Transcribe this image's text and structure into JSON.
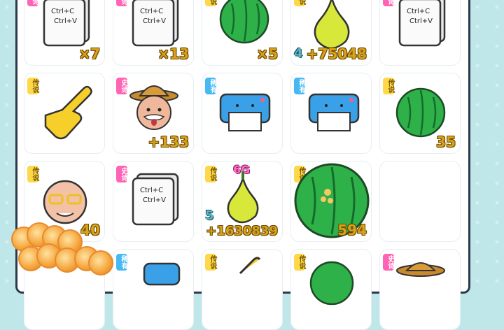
{
  "badges": {
    "legend": "传说",
    "epic": "史诗",
    "rare": "稀有"
  },
  "cells": [
    {
      "id": "r0c0",
      "badge": "史诗",
      "count": "×7"
    },
    {
      "id": "r0c1",
      "badge": "史诗",
      "count": "×13"
    },
    {
      "id": "r0c2",
      "badge": "传说",
      "count": "×5"
    },
    {
      "id": "r0c3",
      "badge": "传说",
      "level": "4",
      "count": "+75048"
    },
    {
      "id": "r0c4",
      "badge": "史诗"
    },
    {
      "id": "r1c0",
      "badge": "传说"
    },
    {
      "id": "r1c1",
      "badge": "史诗",
      "count": "+133"
    },
    {
      "id": "r1c2",
      "badge": "稀有"
    },
    {
      "id": "r1c3",
      "badge": "稀有"
    },
    {
      "id": "r1c4",
      "badge": "传说",
      "count": "35"
    },
    {
      "id": "r2c0",
      "badge": "传说",
      "count": "40"
    },
    {
      "id": "r2c1",
      "badge": "史诗"
    },
    {
      "id": "r2c2",
      "badge": "传说",
      "tag": "6G",
      "level": "5",
      "count": "+1630839"
    },
    {
      "id": "r2c3",
      "badge": "传说",
      "count": "594"
    },
    {
      "id": "r2c4"
    },
    {
      "id": "r3c0"
    },
    {
      "id": "r3c1",
      "badge": "稀有"
    },
    {
      "id": "r3c2",
      "badge": "传说"
    },
    {
      "id": "r3c3",
      "badge": "传说"
    },
    {
      "id": "r3c4",
      "badge": "史诗"
    }
  ],
  "copy_label": "Ctrl+C",
  "paste_label": "Ctrl+V",
  "colors": {
    "legend": "#ffd84a",
    "epic": "#ff63b5",
    "rare": "#46b9f3",
    "count": "#d9a21b"
  }
}
